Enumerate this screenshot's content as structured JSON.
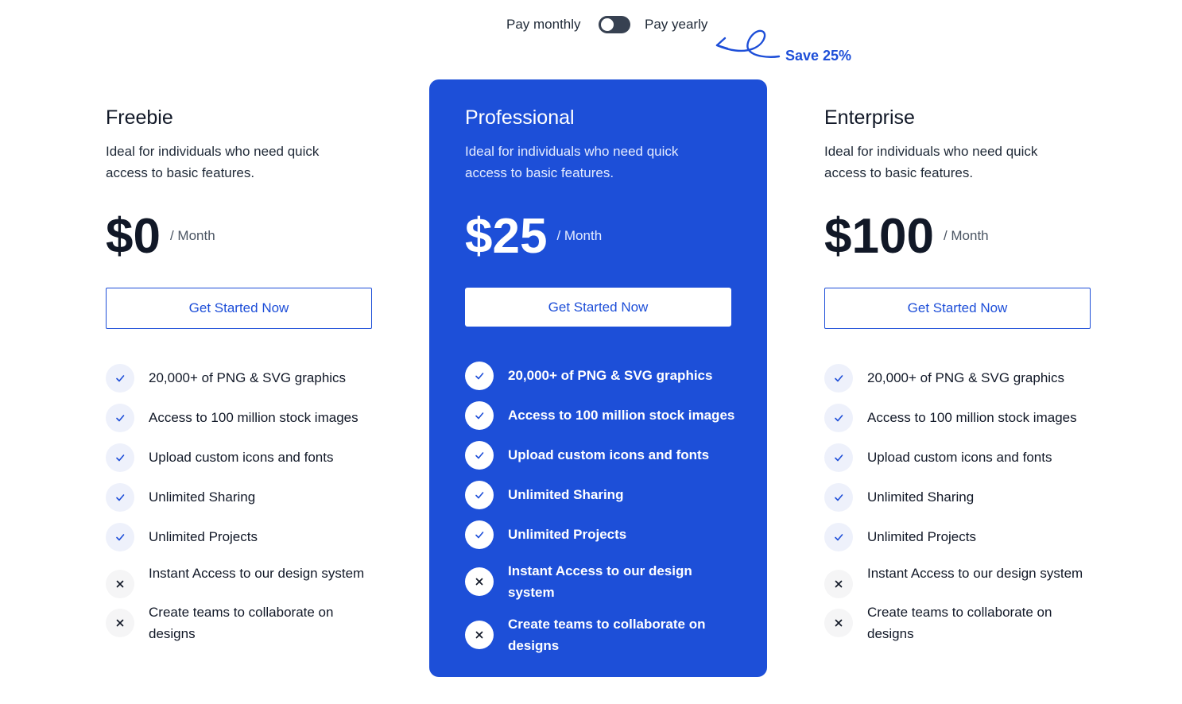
{
  "billing": {
    "monthly_label": "Pay monthly",
    "yearly_label": "Pay yearly",
    "save_label": "Save 25%",
    "selected": "monthly"
  },
  "colors": {
    "accent": "#1d4fd8",
    "check": "#1d4ed8",
    "cross": "#111827"
  },
  "plans": [
    {
      "name": "Freebie",
      "description": "Ideal for individuals who need quick access to basic features.",
      "price": "$0",
      "period": "/ Month",
      "cta": "Get Started Now",
      "features": [
        {
          "label": "20,000+ of PNG & SVG graphics",
          "included": true,
          "icon": "check-icon"
        },
        {
          "label": "Access to 100 million stock images",
          "included": true,
          "icon": "check-icon"
        },
        {
          "label": "Upload custom icons and fonts",
          "included": true,
          "icon": "check-icon"
        },
        {
          "label": "Unlimited Sharing",
          "included": true,
          "icon": "check-icon"
        },
        {
          "label": "Unlimited Projects",
          "included": true,
          "icon": "check-icon"
        },
        {
          "label": "Instant Access to our design system",
          "included": false,
          "icon": "close-icon"
        },
        {
          "label": "Create teams to collaborate on designs",
          "included": false,
          "icon": "close-icon"
        }
      ]
    },
    {
      "name": "Professional",
      "description": "Ideal for individuals who need quick access to basic features.",
      "price": "$25",
      "period": "/ Month",
      "cta": "Get Started Now",
      "features": [
        {
          "label": "20,000+ of PNG & SVG graphics",
          "included": true,
          "icon": "check-icon"
        },
        {
          "label": "Access to 100 million stock images",
          "included": true,
          "icon": "check-icon"
        },
        {
          "label": "Upload custom icons and fonts",
          "included": true,
          "icon": "check-icon"
        },
        {
          "label": "Unlimited Sharing",
          "included": true,
          "icon": "check-icon"
        },
        {
          "label": "Unlimited Projects",
          "included": true,
          "icon": "check-icon"
        },
        {
          "label": "Instant Access to our design system",
          "included": false,
          "icon": "close-icon"
        },
        {
          "label": "Create teams to collaborate on designs",
          "included": false,
          "icon": "close-icon"
        }
      ]
    },
    {
      "name": "Enterprise",
      "description": "Ideal for individuals who need quick access to basic features.",
      "price": "$100",
      "period": "/ Month",
      "cta": "Get Started Now",
      "features": [
        {
          "label": "20,000+ of PNG & SVG graphics",
          "included": true,
          "icon": "check-icon"
        },
        {
          "label": "Access to 100 million stock images",
          "included": true,
          "icon": "check-icon"
        },
        {
          "label": "Upload custom icons and fonts",
          "included": true,
          "icon": "check-icon"
        },
        {
          "label": "Unlimited Sharing",
          "included": true,
          "icon": "check-icon"
        },
        {
          "label": "Unlimited Projects",
          "included": true,
          "icon": "check-icon"
        },
        {
          "label": "Instant Access to our design system",
          "included": false,
          "icon": "close-icon"
        },
        {
          "label": "Create teams to collaborate on designs",
          "included": false,
          "icon": "close-icon"
        }
      ]
    }
  ]
}
